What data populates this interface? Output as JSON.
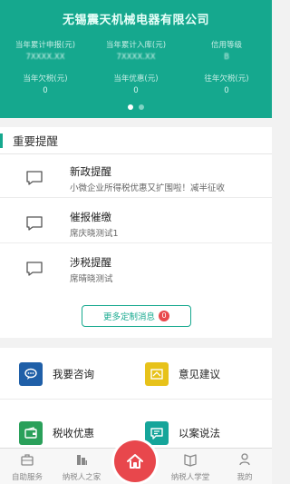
{
  "header": {
    "company": "无锡震天机械电器有限公司",
    "stats_row1": [
      {
        "label": "当年累计申报(元)",
        "value": "7XXXX.XX"
      },
      {
        "label": "当年累计入库(元)",
        "value": "7XXXX.XX"
      },
      {
        "label": "信用等级",
        "value": "B"
      }
    ],
    "stats_row2": [
      {
        "label": "当年欠税(元)",
        "value": "0"
      },
      {
        "label": "当年优惠(元)",
        "value": "0"
      },
      {
        "label": "往年欠税(元)",
        "value": "0"
      }
    ]
  },
  "reminders": {
    "title": "重要提醒",
    "items": [
      {
        "title": "新政提醒",
        "sub": "小微企业所得税优惠又扩围啦！减半征收"
      },
      {
        "title": "催报催缴",
        "sub": "席庆晓测试1"
      },
      {
        "title": "涉税提醒",
        "sub": "席晴晓测试"
      }
    ],
    "more_label": "更多定制消息",
    "more_count": "0"
  },
  "services": [
    {
      "label": "我要咨询",
      "icon": "consult-icon",
      "color": "#1f5fa8"
    },
    {
      "label": "意见建议",
      "icon": "suggestion-icon",
      "color": "#e7c21a"
    },
    {
      "label": "税收优惠",
      "icon": "wallet-icon",
      "color": "#2aa05a"
    },
    {
      "label": "以案说法",
      "icon": "chat-icon",
      "color": "#16a59a"
    }
  ],
  "nav": {
    "items": [
      "自助服务",
      "纳税人之家",
      "纳税人学堂",
      "我的"
    ],
    "home_icon": "home-icon"
  },
  "colors": {
    "brand": "#15a88e",
    "accent": "#e8474c"
  }
}
